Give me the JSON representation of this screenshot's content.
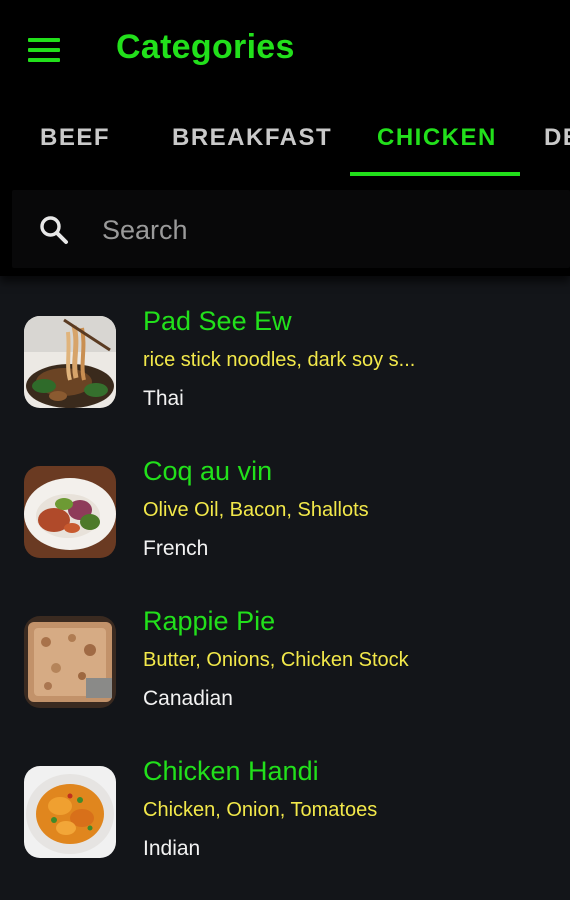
{
  "header": {
    "title": "Categories",
    "menu_icon": "hamburger-menu-icon"
  },
  "tabs": [
    {
      "label": "BEEF",
      "active": false
    },
    {
      "label": "BREAKFAST",
      "active": false
    },
    {
      "label": "CHICKEN",
      "active": true
    },
    {
      "label": "DE",
      "active": false
    }
  ],
  "search": {
    "placeholder": "Search",
    "value": "",
    "icon": "search-icon"
  },
  "meals": [
    {
      "name": "Pad See Ew",
      "ingredients": "rice stick noodles, dark soy s...",
      "area": "Thai"
    },
    {
      "name": "Coq au vin",
      "ingredients": "Olive Oil, Bacon, Shallots",
      "area": "French"
    },
    {
      "name": "Rappie Pie",
      "ingredients": "Butter, Onions, Chicken Stock",
      "area": "Canadian"
    },
    {
      "name": "Chicken Handi",
      "ingredients": "Chicken, Onion, Tomatoes",
      "area": "Indian"
    }
  ],
  "colors": {
    "accent": "#22e01b",
    "ingredients_text": "#f2e84a",
    "background": "#131519",
    "bar_background": "#000000",
    "tab_inactive": "#c9c9c9"
  }
}
